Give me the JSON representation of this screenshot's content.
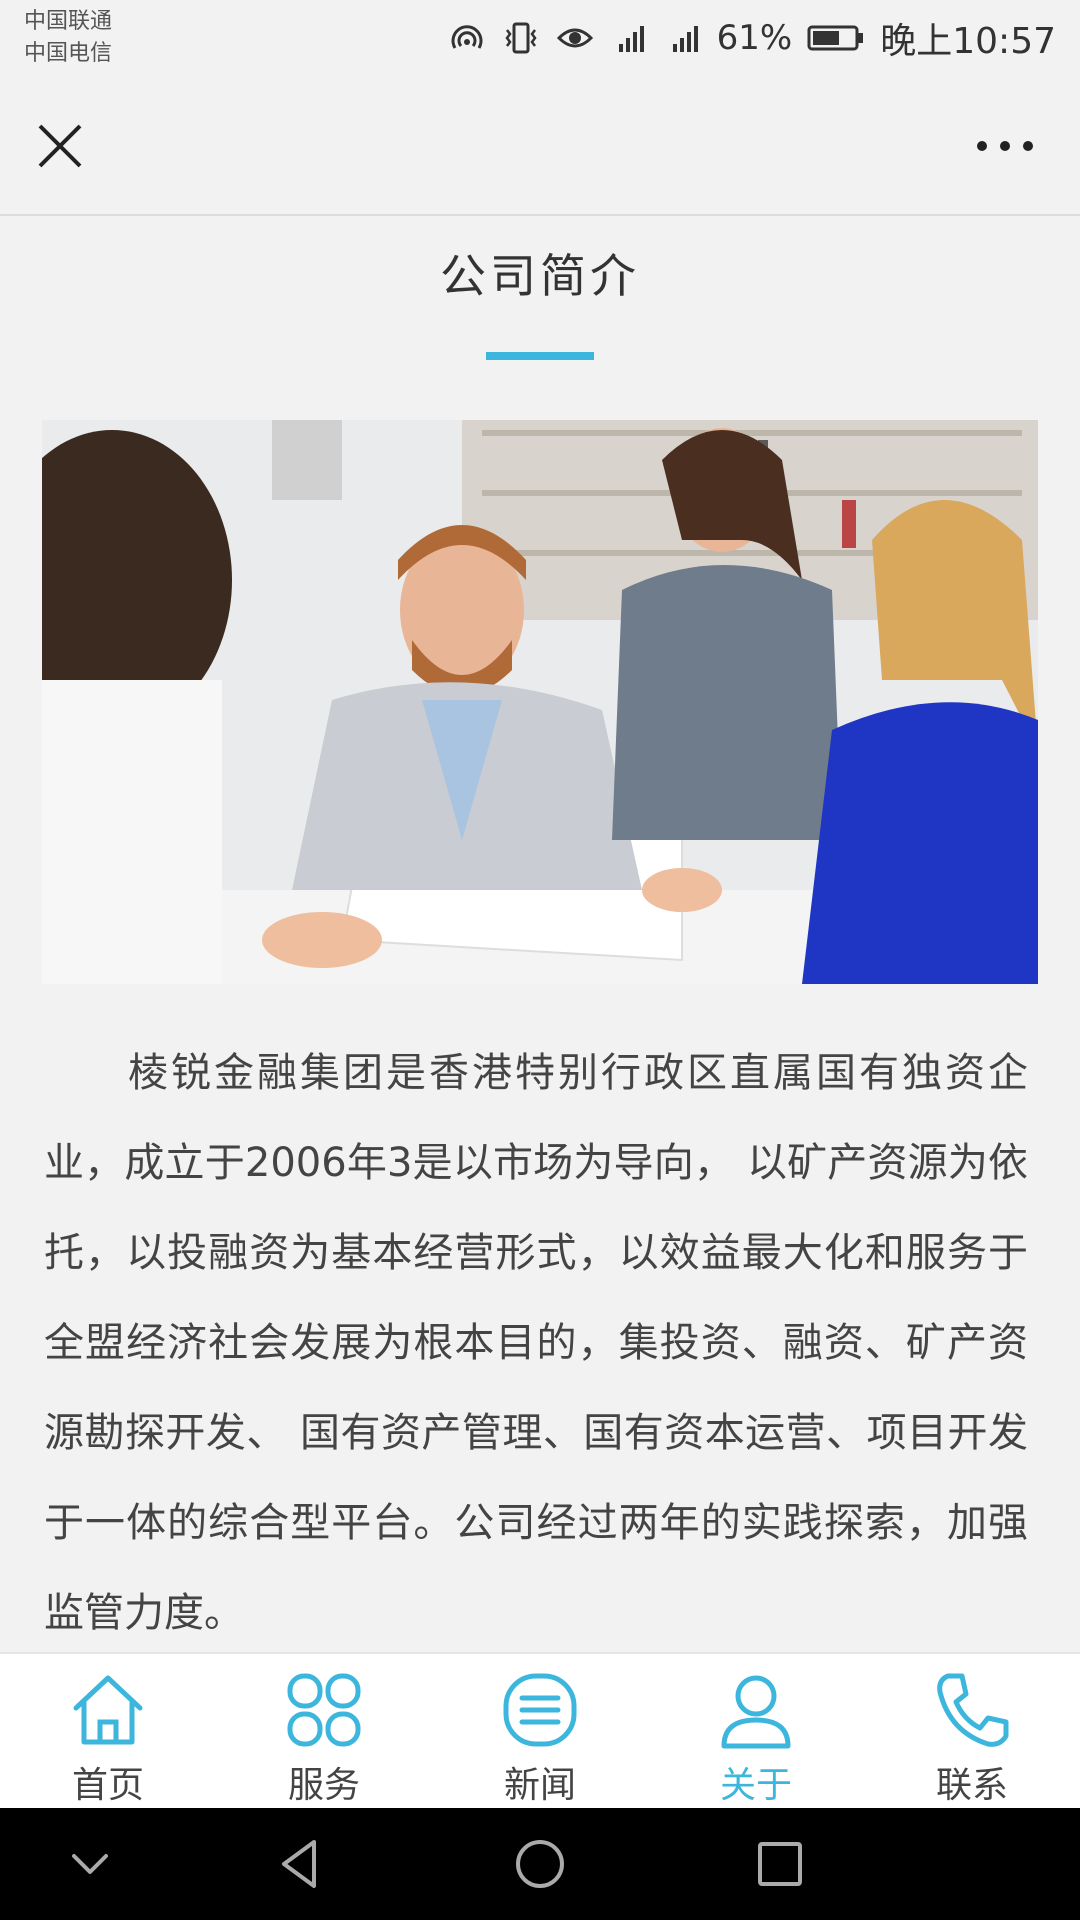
{
  "status_bar": {
    "carriers": [
      "中国联通",
      "中国电信"
    ],
    "battery_percent": "61%",
    "time": "晚上10:57"
  },
  "title_bar": {
    "close_icon": "close-icon",
    "more_icon": "more-icon"
  },
  "page": {
    "title": "公司简介",
    "accent_color": "#3cb6dc",
    "intro_text": "棱锐金融集团是香港特别行政区直属国有独资企业，成立于2006年3是以市场为导向， 以矿产资源为依托，以投融资为基本经营形式，以效益最大化和服务于全盟经济社会发展为根本目的，集投资、融资、矿产资源勘探开发、 国有资产管理、国有资本运营、项目开发于一体的综合型平台。公司经过两年的实践探索，加强监管力度。"
  },
  "bottom_nav": {
    "items": [
      {
        "label": "首页",
        "icon": "home-icon",
        "active": false
      },
      {
        "label": "服务",
        "icon": "grid-icon",
        "active": false
      },
      {
        "label": "新闻",
        "icon": "news-icon",
        "active": false
      },
      {
        "label": "关于",
        "icon": "user-icon",
        "active": true
      },
      {
        "label": "联系",
        "icon": "phone-icon",
        "active": false
      }
    ]
  },
  "system_nav": {
    "buttons": [
      "chevron-down-icon",
      "back-icon",
      "home-circle-icon",
      "recents-icon"
    ]
  }
}
